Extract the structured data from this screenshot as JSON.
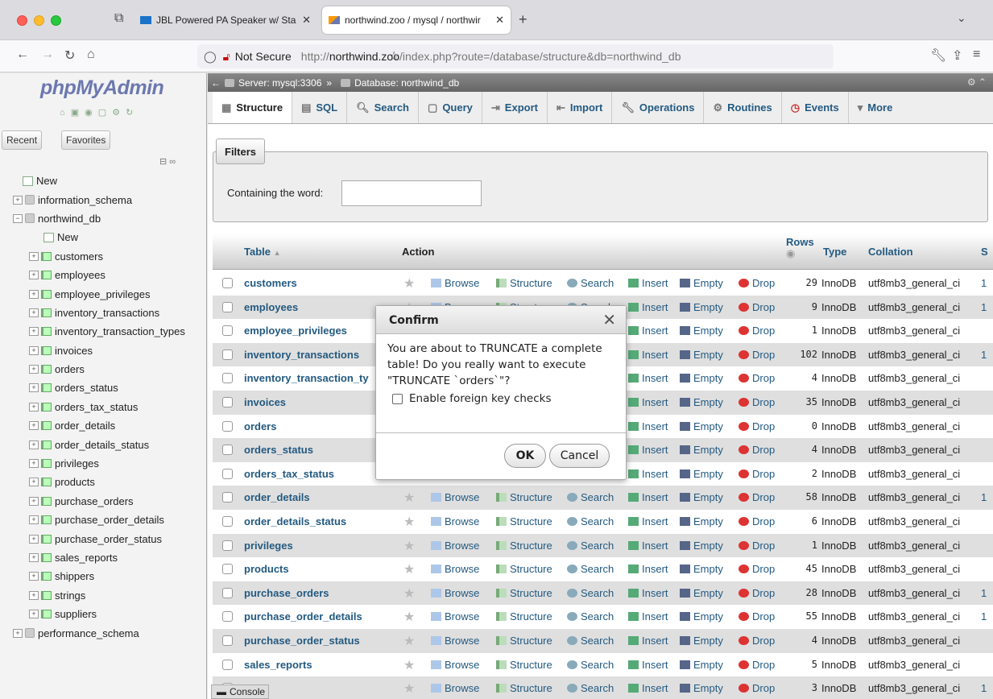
{
  "browser": {
    "tabs": [
      {
        "title": "JBL Powered PA Speaker w/ Sta"
      },
      {
        "title": "northwind.zoo / mysql / northwir",
        "active": true
      }
    ],
    "url_security": "Not Secure",
    "url_prefix": "http://",
    "url_host": "northwind.zoo",
    "url_path": "/index.php?route=/database/structure&db=northwind_db"
  },
  "sidebar": {
    "logo": "phpMyAdmin",
    "recent_label": "Recent",
    "favorites_label": "Favorites",
    "top_items": [
      {
        "label": "New"
      },
      {
        "label": "information_schema"
      },
      {
        "label": "northwind_db"
      }
    ],
    "db_new": "New",
    "tables": [
      "customers",
      "employees",
      "employee_privileges",
      "inventory_transactions",
      "inventory_transaction_types",
      "invoices",
      "orders",
      "orders_status",
      "orders_tax_status",
      "order_details",
      "order_details_status",
      "privileges",
      "products",
      "purchase_orders",
      "purchase_order_details",
      "purchase_order_status",
      "sales_reports",
      "shippers",
      "strings",
      "suppliers"
    ],
    "bottom_item": "performance_schema"
  },
  "breadcrumb": {
    "server": "Server: mysql:3306",
    "database": "Database: northwind_db"
  },
  "menu": {
    "tabs": [
      "Structure",
      "SQL",
      "Search",
      "Query",
      "Export",
      "Import",
      "Operations",
      "Routines",
      "Events",
      "More"
    ],
    "active": "Structure"
  },
  "filters": {
    "legend": "Filters",
    "label": "Containing the word:",
    "value": ""
  },
  "table": {
    "headers": {
      "table": "Table",
      "action": "Action",
      "rows": "Rows",
      "type": "Type",
      "collation": "Collation",
      "last": "S"
    },
    "actions": {
      "browse": "Browse",
      "structure": "Structure",
      "search": "Search",
      "insert": "Insert",
      "empty": "Empty",
      "drop": "Drop"
    },
    "rows": [
      {
        "name": "customers",
        "rows": "29",
        "type": "InnoDB",
        "collation": "utf8mb3_general_ci",
        "last": "1"
      },
      {
        "name": "employees",
        "rows": "9",
        "type": "InnoDB",
        "collation": "utf8mb3_general_ci",
        "last": "1"
      },
      {
        "name": "employee_privileges",
        "rows": "1",
        "type": "InnoDB",
        "collation": "utf8mb3_general_ci",
        "last": ""
      },
      {
        "name": "inventory_transactions",
        "rows": "102",
        "type": "InnoDB",
        "collation": "utf8mb3_general_ci",
        "last": "1"
      },
      {
        "name": "inventory_transaction_ty",
        "rows": "4",
        "type": "InnoDB",
        "collation": "utf8mb3_general_ci",
        "last": ""
      },
      {
        "name": "invoices",
        "rows": "35",
        "type": "InnoDB",
        "collation": "utf8mb3_general_ci",
        "last": ""
      },
      {
        "name": "orders",
        "rows": "0",
        "type": "InnoDB",
        "collation": "utf8mb3_general_ci",
        "last": ""
      },
      {
        "name": "orders_status",
        "rows": "4",
        "type": "InnoDB",
        "collation": "utf8mb3_general_ci",
        "last": ""
      },
      {
        "name": "orders_tax_status",
        "rows": "2",
        "type": "InnoDB",
        "collation": "utf8mb3_general_ci",
        "last": ""
      },
      {
        "name": "order_details",
        "rows": "58",
        "type": "InnoDB",
        "collation": "utf8mb3_general_ci",
        "last": "1"
      },
      {
        "name": "order_details_status",
        "rows": "6",
        "type": "InnoDB",
        "collation": "utf8mb3_general_ci",
        "last": ""
      },
      {
        "name": "privileges",
        "rows": "1",
        "type": "InnoDB",
        "collation": "utf8mb3_general_ci",
        "last": ""
      },
      {
        "name": "products",
        "rows": "45",
        "type": "InnoDB",
        "collation": "utf8mb3_general_ci",
        "last": ""
      },
      {
        "name": "purchase_orders",
        "rows": "28",
        "type": "InnoDB",
        "collation": "utf8mb3_general_ci",
        "last": "1"
      },
      {
        "name": "purchase_order_details",
        "rows": "55",
        "type": "InnoDB",
        "collation": "utf8mb3_general_ci",
        "last": "1"
      },
      {
        "name": "purchase_order_status",
        "rows": "4",
        "type": "InnoDB",
        "collation": "utf8mb3_general_ci",
        "last": ""
      },
      {
        "name": "sales_reports",
        "rows": "5",
        "type": "InnoDB",
        "collation": "utf8mb3_general_ci",
        "last": ""
      },
      {
        "name": "rs",
        "rows": "3",
        "type": "InnoDB",
        "collation": "utf8mb3_general_ci",
        "last": "1"
      }
    ]
  },
  "console_label": "Console",
  "dialog": {
    "title": "Confirm",
    "message": "You are about to TRUNCATE a complete table! Do you really want to execute \"TRUNCATE `orders`\"?",
    "checkbox_label": "Enable foreign key checks",
    "ok": "OK",
    "cancel": "Cancel"
  },
  "colors": {
    "link": "#235a81",
    "drop": "#d33",
    "logo": "#6c78af"
  }
}
